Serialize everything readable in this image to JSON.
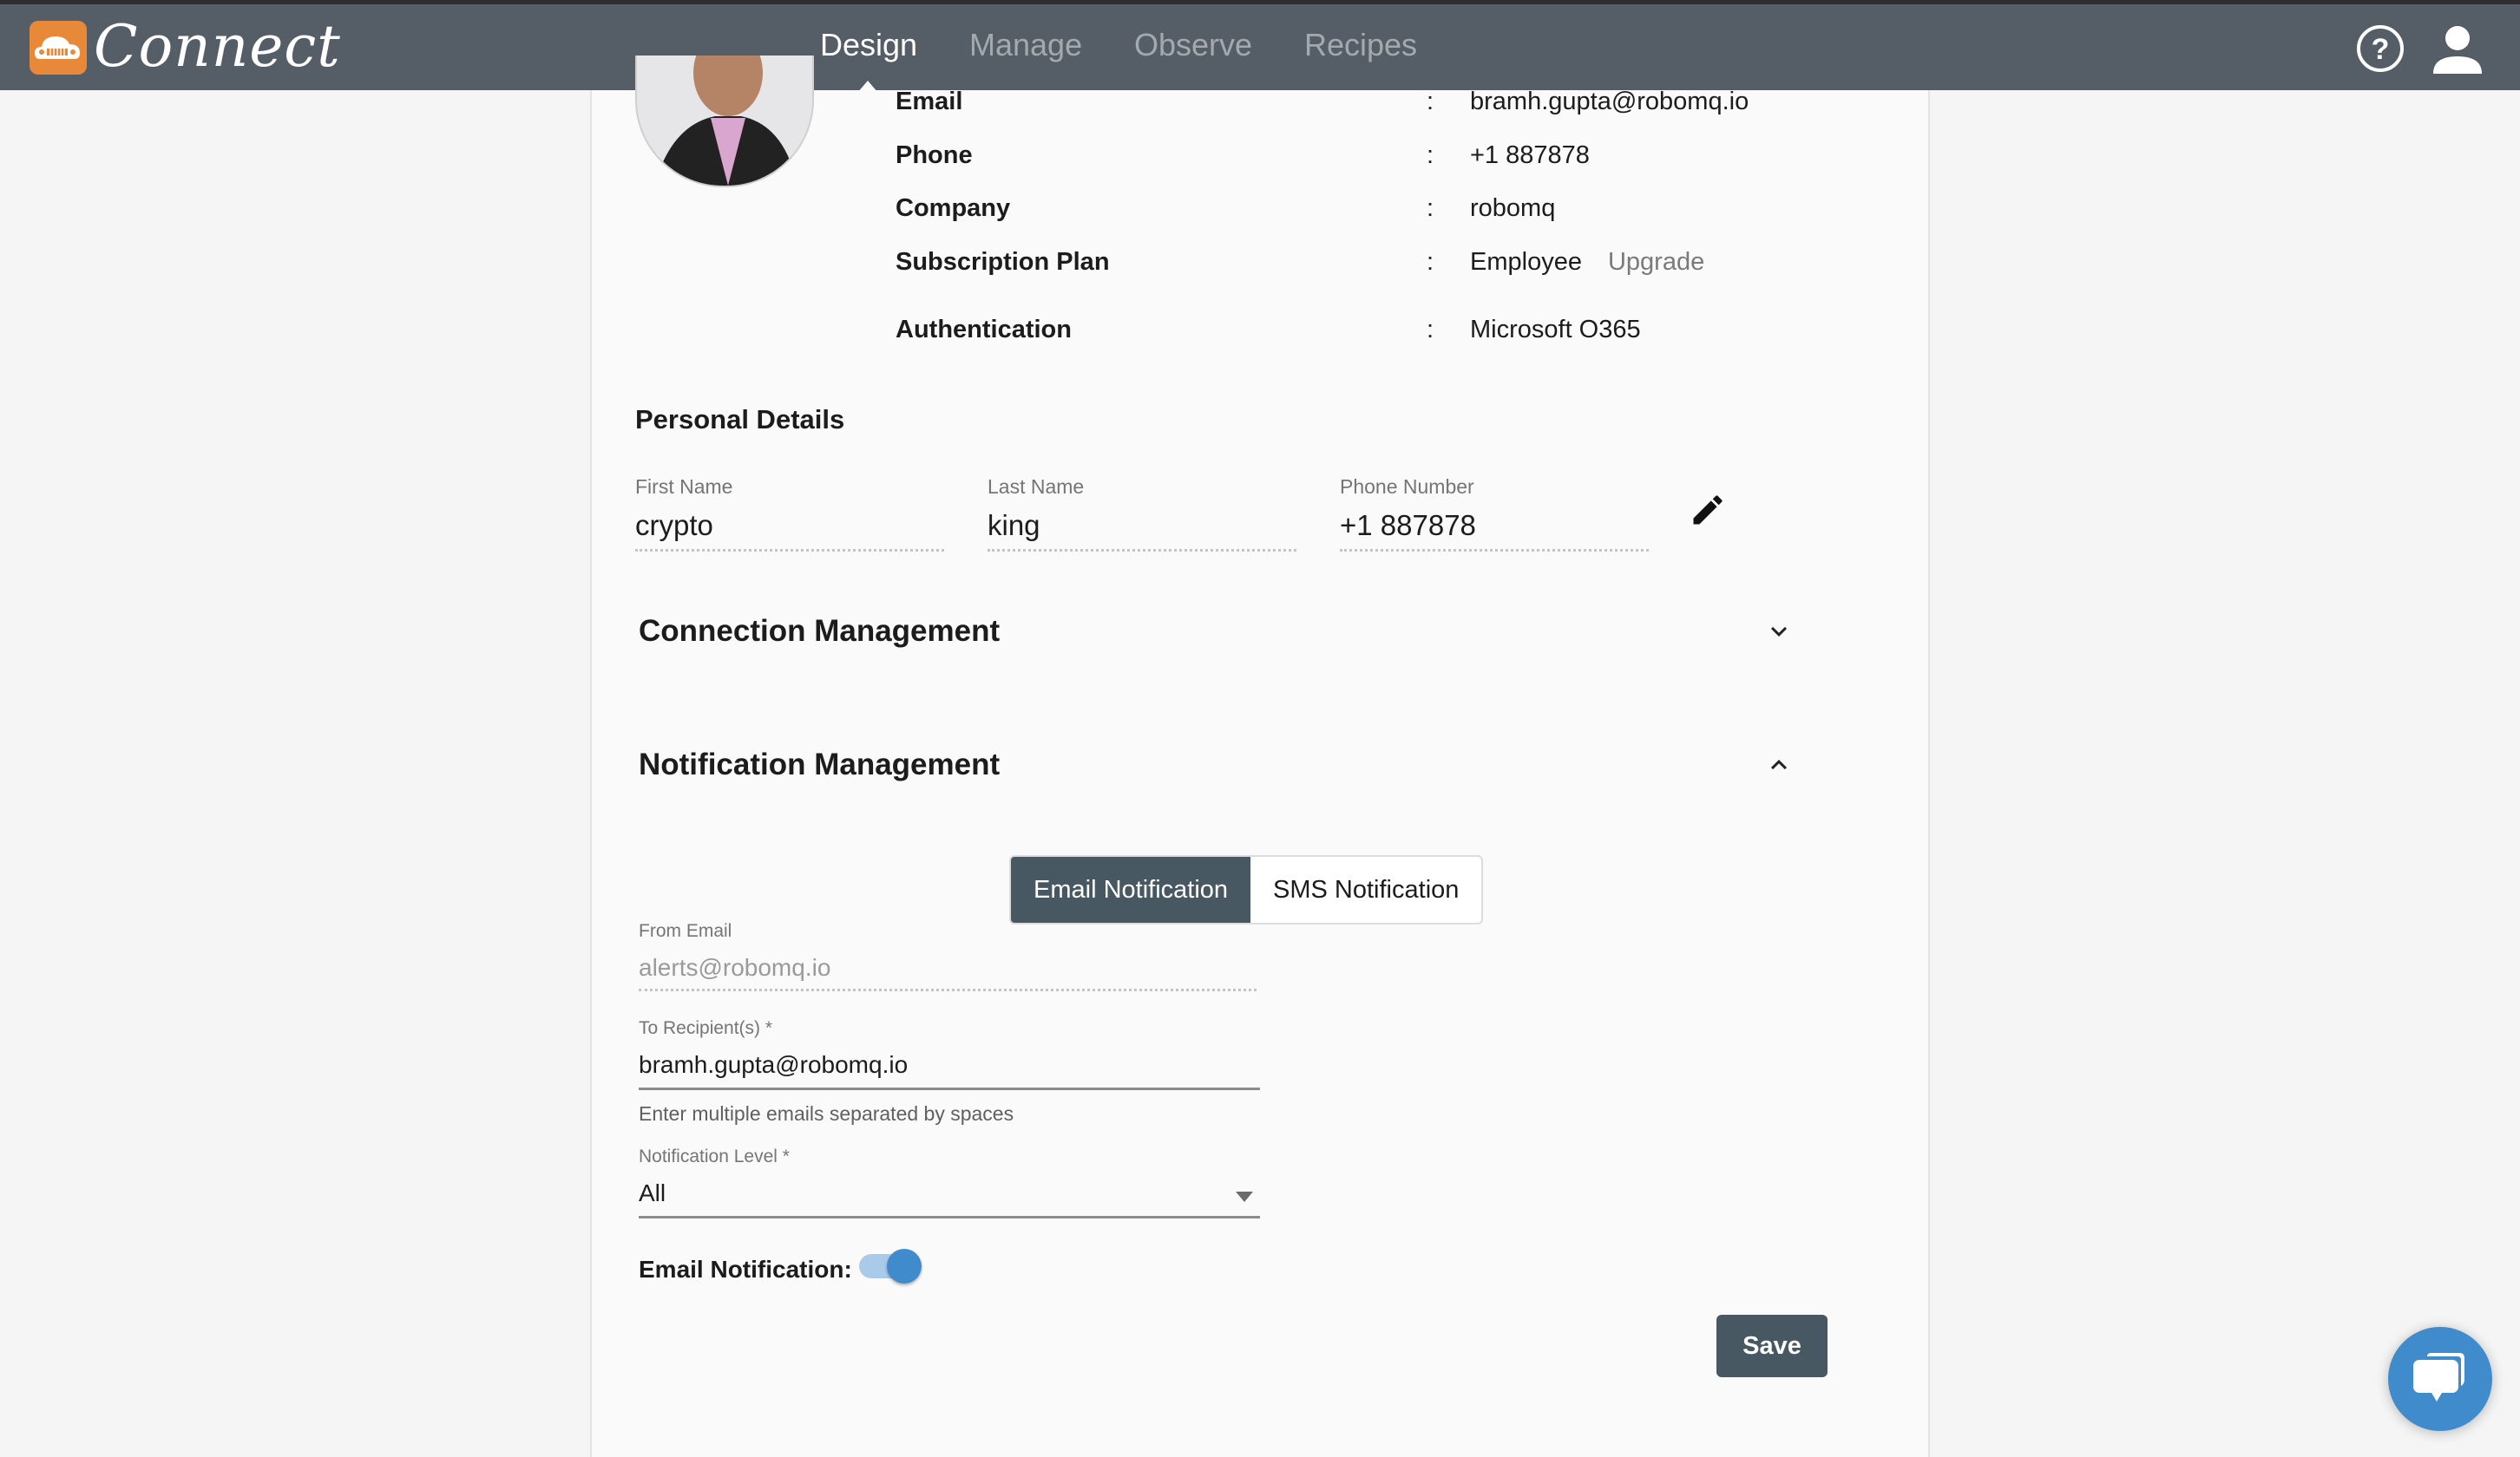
{
  "header": {
    "app_name": "Connect",
    "nav": [
      {
        "label": "Design",
        "active": true
      },
      {
        "label": "Manage",
        "active": false
      },
      {
        "label": "Observe",
        "active": false
      },
      {
        "label": "Recipes",
        "active": false
      }
    ],
    "icons": [
      "help-icon",
      "user-account-icon"
    ]
  },
  "profile": {
    "rows": [
      {
        "label": "Email",
        "colon": ":",
        "value": "bramh.gupta@robomq.io"
      },
      {
        "label": "Phone",
        "colon": ":",
        "value": "+1 887878"
      },
      {
        "label": "Company",
        "colon": ":",
        "value": "robomq"
      },
      {
        "label": "Subscription Plan",
        "colon": ":",
        "value": "Employee",
        "link": "Upgrade"
      },
      {
        "label": "Authentication",
        "colon": ":",
        "value": "Microsoft O365"
      }
    ]
  },
  "personal": {
    "title": "Personal Details",
    "first_name": {
      "label": "First Name",
      "value": "crypto"
    },
    "last_name": {
      "label": "Last Name",
      "value": "king"
    },
    "phone": {
      "label": "Phone Number",
      "value": "+1 887878"
    }
  },
  "sections": {
    "connection": {
      "title": "Connection Management",
      "expanded": false
    },
    "notification": {
      "title": "Notification Management",
      "expanded": true
    }
  },
  "notification": {
    "tabs": [
      {
        "label": "Email Notification",
        "active": true
      },
      {
        "label": "SMS Notification",
        "active": false
      }
    ],
    "from_email": {
      "label": "From Email",
      "value": "alerts@robomq.io"
    },
    "to_recipients": {
      "label": "To Recipient(s) *",
      "value": "bramh.gupta@robomq.io",
      "hint": "Enter multiple emails separated by spaces"
    },
    "level": {
      "label": "Notification Level *",
      "value": "All"
    },
    "email_toggle": {
      "label": "Email Notification:",
      "on": true
    },
    "save_label": "Save"
  },
  "colors": {
    "header_bg": "#555e66",
    "brand_orange": "#e8893a",
    "button_dark": "#485862",
    "accent_blue": "#3f8bcb"
  }
}
